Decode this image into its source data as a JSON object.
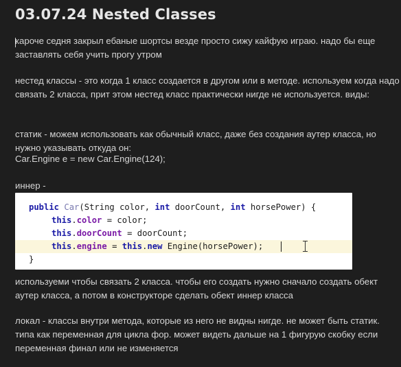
{
  "note": {
    "title": "03.07.24 Nested Classes",
    "paragraphs": {
      "p1": "кароче седня закрыл ебаные шортсы везде просто сижу кайфую играю. надо бы еще заставлять себя учить прогу утром",
      "p2": "нестед классы - это когда 1 класс создается в другом или в методе. используем когда надо связать 2 класса, прит этом нестед класс практически нигде не используется. виды:",
      "p3": "статик - можем использовать как обычный класс, даже без создания аутер класса, но нужно указывать откуда он:",
      "p4": "Car.Engine e = new Car.Engine(124);",
      "p5": "иннер -",
      "p6": "используеми чтобы связать 2 класса. чтобы его создать нужно сначало создать обект аутер класса, а потом в конструкторе сделать обект иннер класса",
      "p7": "локал - классы внутри метода, которые из него не видны нигде. не может быть статик. типа как переменная для цикла фор. может видеть дальше на 1 фигурую скобку если переменная финал или не изменяется"
    },
    "code_image": {
      "line1": {
        "kw1": "public",
        "cls": "Car",
        "rest1": "(String color, ",
        "kw2": "int",
        "rest2": " doorCount, ",
        "kw3": "int",
        "rest3": " horsePower) {"
      },
      "line2": {
        "kw": "this",
        "fld": "color",
        "rest": " = color;"
      },
      "line3": {
        "kw": "this",
        "fld": "doorCount",
        "rest": " = doorCount;"
      },
      "line4": {
        "kw": "this",
        "fld": "engine",
        "mid": " = ",
        "kw2": "this",
        "kw3": "new",
        "rest": " Engine(horsePower);"
      },
      "line5": "}"
    }
  }
}
